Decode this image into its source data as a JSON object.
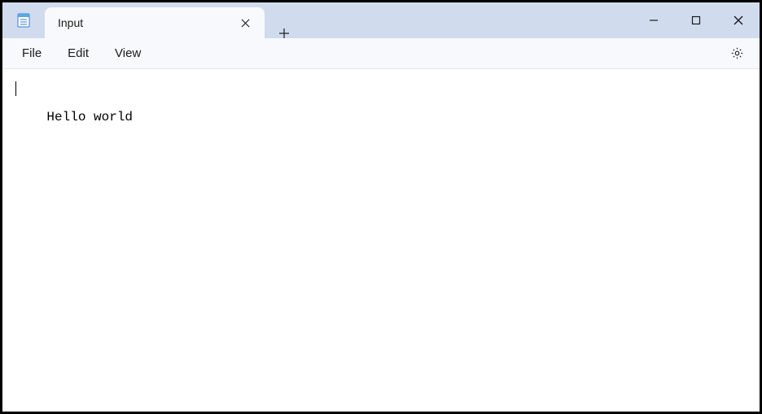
{
  "titlebar": {
    "tab_title": "Input"
  },
  "menu": {
    "file": "File",
    "edit": "Edit",
    "view": "View"
  },
  "editor": {
    "content": "Hello world"
  }
}
